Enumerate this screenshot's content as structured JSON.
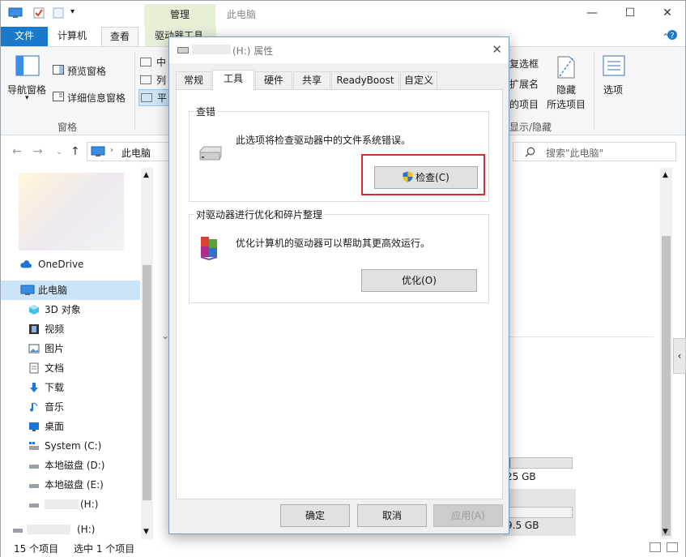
{
  "explorer": {
    "title": "此电脑",
    "manage_tab": "管理",
    "window_controls": [
      "—",
      "☐",
      "✕"
    ],
    "ribbon_tabs": [
      "文件",
      "计算机",
      "查看",
      "驱动器工具"
    ],
    "ribbon": {
      "nav_pane": "导航窗格",
      "preview_pane": "预览窗格",
      "details_pane": "详细信息窗格",
      "pane_group": "窗格",
      "layout_items": [
        "中",
        "列",
        "平"
      ],
      "checkbox_items": [
        "复选框",
        "扩展名",
        "的项目"
      ],
      "hide_selected": "隐藏",
      "hide_selected_line2": "所选项目",
      "options": "选项",
      "show_hide_group": "显示/隐藏"
    },
    "address": "此电脑",
    "search_placeholder": "搜索\"此电脑\"",
    "nav_items": [
      {
        "label": "OneDrive",
        "icon": "cloud-icon"
      },
      {
        "label": "此电脑",
        "icon": "computer-icon"
      },
      {
        "label": "3D 对象",
        "icon": "cube-icon"
      },
      {
        "label": "视频",
        "icon": "film-icon"
      },
      {
        "label": "图片",
        "icon": "picture-icon"
      },
      {
        "label": "文档",
        "icon": "document-icon"
      },
      {
        "label": "下载",
        "icon": "download-arrow-icon"
      },
      {
        "label": "音乐",
        "icon": "music-note-icon"
      },
      {
        "label": "桌面",
        "icon": "desktop-icon"
      },
      {
        "label": "System (C:)",
        "icon": "system-drive-icon"
      },
      {
        "label": "本地磁盘 (D:)",
        "icon": "drive-icon"
      },
      {
        "label": "本地磁盘 (E:)",
        "icon": "drive-icon"
      },
      {
        "label": "(H:)",
        "icon": "drive-icon"
      },
      {
        "label": "(H:)",
        "icon": "drive-icon"
      }
    ],
    "right_sizes": [
      "25 GB",
      "9.5 GB"
    ],
    "right_bar_fill": 0.05,
    "status_items": "15 个项目",
    "status_selected": "选中 1 个项目"
  },
  "dialog": {
    "title": "(H:) 属性",
    "tabs": [
      "常规",
      "工具",
      "硬件",
      "共享",
      "ReadyBoost",
      "自定义"
    ],
    "active_tab": "工具",
    "error_check": {
      "title": "查错",
      "desc": "此选项将检查驱动器中的文件系统错误。",
      "button": "检查(C)"
    },
    "optimize": {
      "title": "对驱动器进行优化和碎片整理",
      "desc": "优化计算机的驱动器可以帮助其更高效运行。",
      "button": "优化(O)"
    },
    "buttons": {
      "ok": "确定",
      "cancel": "取消",
      "apply": "应用(A)"
    }
  }
}
